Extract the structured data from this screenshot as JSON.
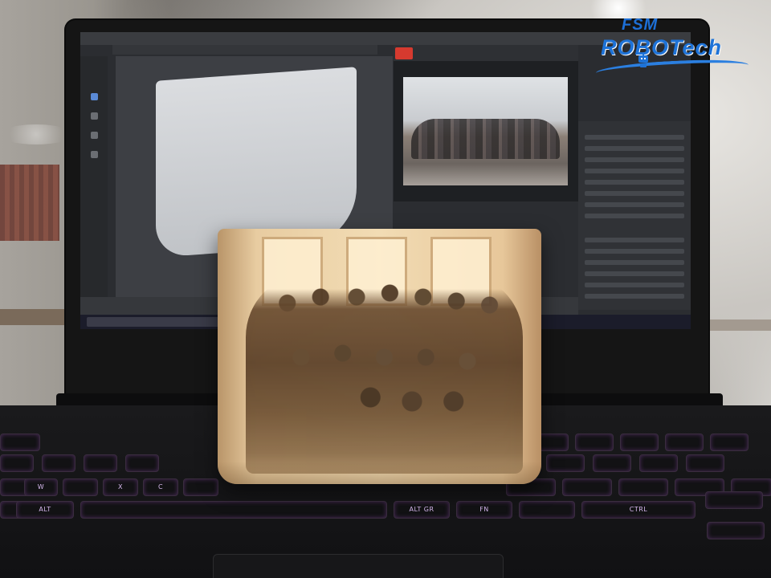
{
  "logo": {
    "line1": "FSM",
    "line2": "ROBOTech",
    "brand_color": "#1e73d8"
  },
  "keyboard": {
    "keys": {
      "alt_left": "ALT",
      "alt_gr": "ALT GR",
      "fn": "FN",
      "ctrl_right": "CTRL",
      "w": "W",
      "x": "X",
      "c": "C"
    },
    "backlight_color": "#c77cf0"
  },
  "icons": {
    "robot": "robot-icon"
  }
}
